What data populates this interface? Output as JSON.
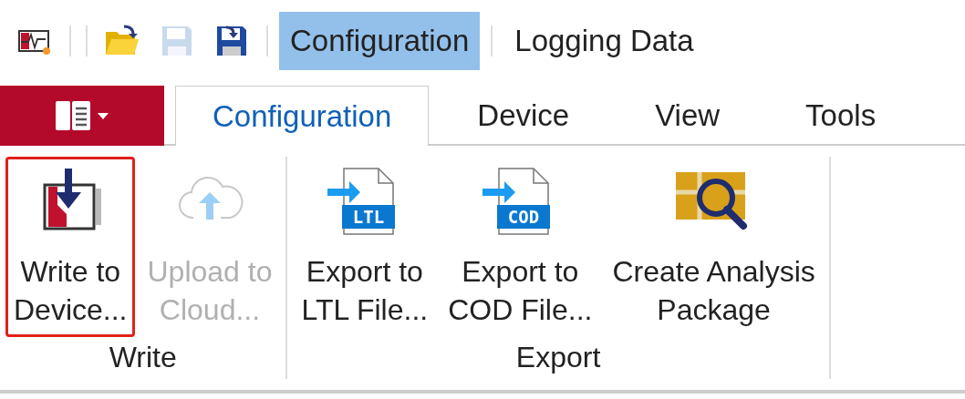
{
  "quick_access": [
    {
      "kind": "app",
      "disabled": false
    },
    {
      "kind": "open",
      "disabled": false
    },
    {
      "kind": "save",
      "disabled": true
    },
    {
      "kind": "save-as",
      "disabled": false
    }
  ],
  "modes": [
    {
      "label": "Configuration",
      "selected": true
    },
    {
      "label": "Logging Data",
      "selected": false
    }
  ],
  "ribbon_tabs": [
    {
      "label": "Configuration",
      "selected": true
    },
    {
      "label": "Device",
      "selected": false
    },
    {
      "label": "View",
      "selected": false
    },
    {
      "label": "Tools",
      "selected": false
    }
  ],
  "groups": [
    {
      "label": "Write",
      "buttons": [
        {
          "kind": "write",
          "label": "Write to Device...",
          "highlighted": true,
          "disabled": false
        },
        {
          "kind": "upload",
          "label": "Upload to Cloud...",
          "highlighted": false,
          "disabled": true
        }
      ]
    },
    {
      "label": "Export",
      "buttons": [
        {
          "kind": "export-file",
          "badge": "LTL",
          "label": "Export to LTL File...",
          "highlighted": false,
          "disabled": false
        },
        {
          "kind": "export-file",
          "badge": "COD",
          "label": "Export to COD File...",
          "highlighted": false,
          "disabled": false
        },
        {
          "kind": "analysis",
          "label": "Create Analysis Package",
          "highlighted": false,
          "disabled": false
        }
      ]
    }
  ]
}
